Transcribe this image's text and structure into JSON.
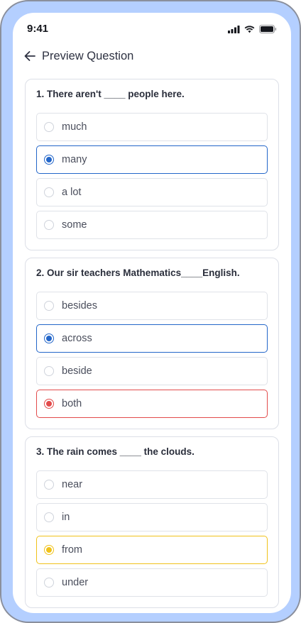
{
  "status_bar": {
    "time": "9:41"
  },
  "header": {
    "title": "Preview Question",
    "back_icon": "arrow-left-icon"
  },
  "colors": {
    "frame": "#b4cfff",
    "selected_blue": "#2366c9",
    "wrong_red": "#e24b4b",
    "warning_yellow": "#f0c21a"
  },
  "questions": [
    {
      "title": "1. There aren't ____ people here.",
      "options": [
        {
          "label": "much",
          "state": "none"
        },
        {
          "label": "many",
          "state": "selected-blue"
        },
        {
          "label": "a lot",
          "state": "none"
        },
        {
          "label": "some",
          "state": "none"
        }
      ]
    },
    {
      "title": "2. Our sir teachers Mathematics____English.",
      "options": [
        {
          "label": "besides",
          "state": "none"
        },
        {
          "label": "across",
          "state": "selected-blue"
        },
        {
          "label": "beside",
          "state": "none"
        },
        {
          "label": "both",
          "state": "selected-red"
        }
      ]
    },
    {
      "title": "3. The rain comes ____ the clouds.",
      "options": [
        {
          "label": "near",
          "state": "none"
        },
        {
          "label": "in",
          "state": "none"
        },
        {
          "label": "from",
          "state": "selected-yellow"
        },
        {
          "label": "under",
          "state": "none"
        }
      ]
    }
  ]
}
